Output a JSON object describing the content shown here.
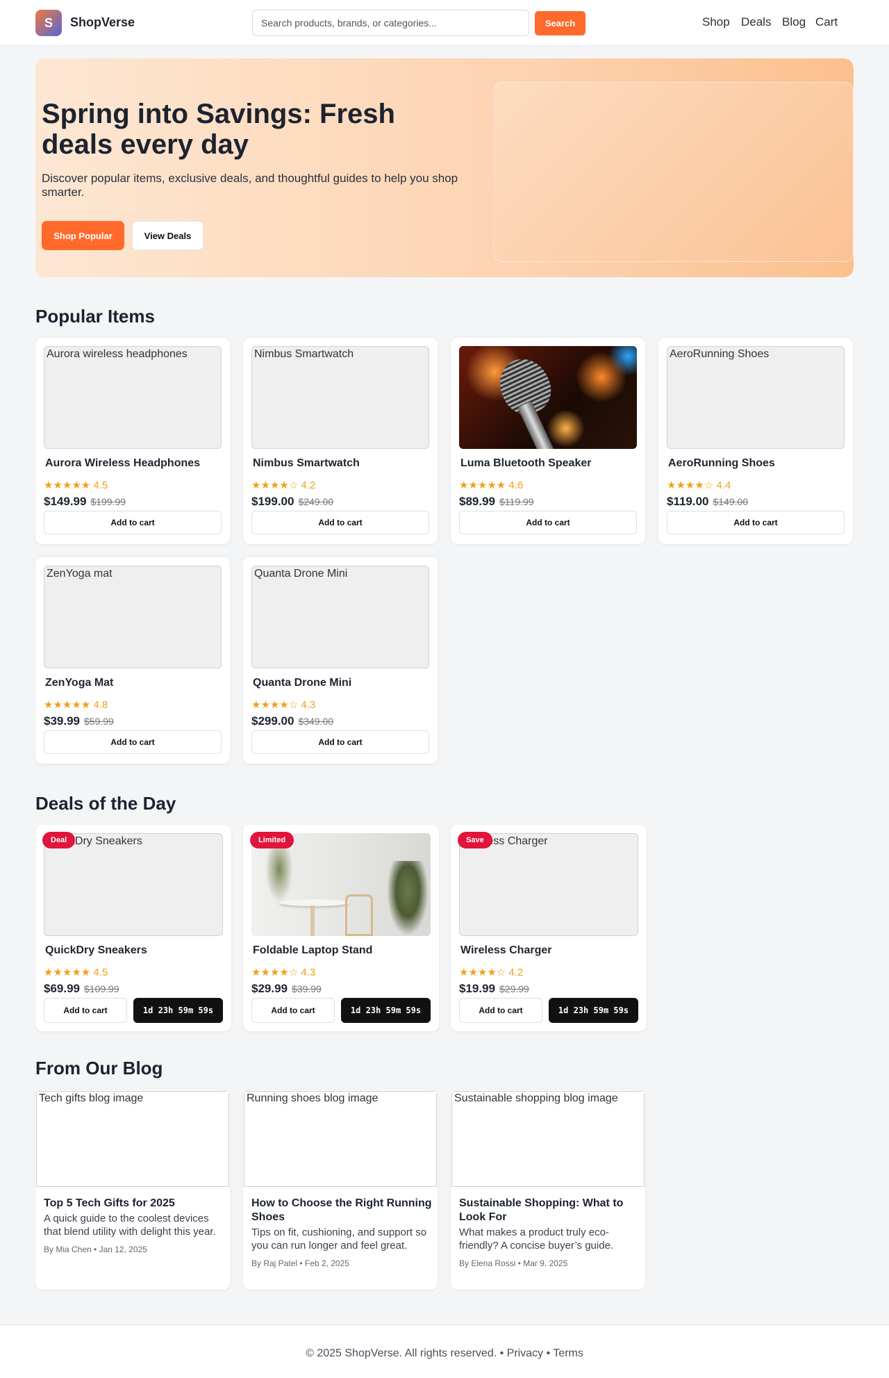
{
  "header": {
    "logo_letter": "S",
    "brand": "ShopVerse",
    "search_placeholder": "Search products, brands, or categories...",
    "search_button": "Search",
    "nav": [
      "Shop",
      "Deals",
      "Blog",
      "Cart"
    ]
  },
  "hero": {
    "title": "Spring into Savings: Fresh deals every day",
    "subtitle": "Discover popular items, exclusive deals, and thoughtful guides to help you shop smarter.",
    "primary_button": "Shop Popular",
    "secondary_button": "View Deals"
  },
  "popular": {
    "title": "Popular Items",
    "items": [
      {
        "alt": "Aurora wireless headphones",
        "name": "Aurora Wireless Headphones",
        "stars": "★★★★★",
        "rating": "4.5",
        "price": "$149.99",
        "old_price": "$199.99",
        "button": "Add to cart"
      },
      {
        "alt": "Nimbus Smartwatch",
        "name": "Nimbus Smartwatch",
        "stars": "★★★★☆",
        "rating": "4.2",
        "price": "$199.00",
        "old_price": "$249.00",
        "button": "Add to cart"
      },
      {
        "alt": "Luma Bluetooth Speaker",
        "name": "Luma Bluetooth Speaker",
        "stars": "★★★★★",
        "rating": "4.6",
        "price": "$89.99",
        "old_price": "$119.99",
        "button": "Add to cart"
      },
      {
        "alt": "AeroRunning Shoes",
        "name": "AeroRunning Shoes",
        "stars": "★★★★☆",
        "rating": "4.4",
        "price": "$119.00",
        "old_price": "$149.00",
        "button": "Add to cart"
      },
      {
        "alt": "ZenYoga mat",
        "name": "ZenYoga Mat",
        "stars": "★★★★★",
        "rating": "4.8",
        "price": "$39.99",
        "old_price": "$59.99",
        "button": "Add to cart"
      },
      {
        "alt": "Quanta Drone Mini",
        "name": "Quanta Drone Mini",
        "stars": "★★★★☆",
        "rating": "4.3",
        "price": "$299.00",
        "old_price": "$349.00",
        "button": "Add to cart"
      }
    ]
  },
  "deals": {
    "title": "Deals of the Day",
    "items": [
      {
        "badge": "Deal",
        "alt": "QuickDry Sneakers",
        "name": "QuickDry Sneakers",
        "stars": "★★★★★",
        "rating": "4.5",
        "price": "$69.99",
        "old_price": "$109.99",
        "button": "Add to cart",
        "timer": "1d 23h 59m 59s"
      },
      {
        "badge": "Limited",
        "alt": "Foldable Laptop Stand",
        "name": "Foldable Laptop Stand",
        "stars": "★★★★☆",
        "rating": "4.3",
        "price": "$29.99",
        "old_price": "$39.99",
        "button": "Add to cart",
        "timer": "1d 23h 59m 59s"
      },
      {
        "badge": "Save",
        "alt": "Wireless Charger",
        "name": "Wireless Charger",
        "stars": "★★★★☆",
        "rating": "4.2",
        "price": "$19.99",
        "old_price": "$29.99",
        "button": "Add to cart",
        "timer": "1d 23h 59m 59s"
      }
    ]
  },
  "blog": {
    "title": "From Our Blog",
    "posts": [
      {
        "alt": "Tech gifts blog image",
        "title": "Top 5 Tech Gifts for 2025",
        "excerpt": "A quick guide to the coolest devices that blend utility with delight this year.",
        "meta": "By Mia Chen • Jan 12, 2025"
      },
      {
        "alt": "Running shoes blog image",
        "title": "How to Choose the Right Running Shoes",
        "excerpt": "Tips on fit, cushioning, and support so you can run longer and feel great.",
        "meta": "By Raj Patel • Feb 2, 2025"
      },
      {
        "alt": "Sustainable shopping blog image",
        "title": "Sustainable Shopping: What to Look For",
        "excerpt": "What makes a product truly eco-friendly? A concise buyer’s guide.",
        "meta": "By Elena Rossi • Mar 9, 2025"
      }
    ]
  },
  "footer": {
    "copyright": "© 2025 ShopVerse. All rights reserved.",
    "sep1": " • ",
    "privacy": "Privacy",
    "sep2": " • ",
    "terms": "Terms"
  },
  "colors": {
    "accent": "#ff6a2a",
    "badge": "#e0143c",
    "star": "#f0a019"
  }
}
